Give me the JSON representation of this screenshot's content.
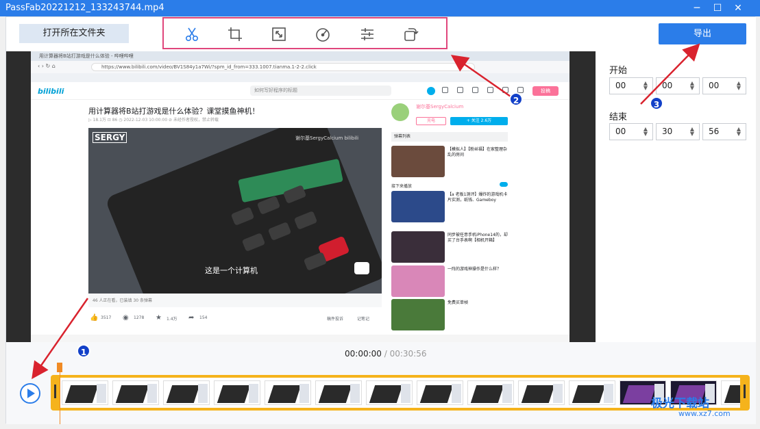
{
  "window": {
    "title": "PassFab20221212_133243744.mp4",
    "minimize_glyph": "─",
    "maximize_glyph": "☐",
    "close_glyph": "✕"
  },
  "toolbar": {
    "open_folder_label": "打开所在文件夹",
    "export_label": "导出",
    "tools": [
      "scissors-icon",
      "crop-icon",
      "resize-icon",
      "speed-icon",
      "adjust-icon",
      "rotate-icon"
    ]
  },
  "trim": {
    "start_label": "开始",
    "start": [
      "00",
      "00",
      "00"
    ],
    "end_label": "结束",
    "end": [
      "00",
      "30",
      "56"
    ]
  },
  "playback": {
    "current_time": "00:00:00",
    "separator": " / ",
    "total_time": "00:30:56"
  },
  "annotations": {
    "badge_1": "1",
    "badge_2": "2",
    "badge_3": "3",
    "arrow_color": "#d9232e"
  },
  "preview": {
    "browser_tab_1": "用计算器将B站打游戏是什么体验 - 哔哩哔哩",
    "address": "https://www.bilibili.com/video/BV1S84y1a7Wi/?spm_id_from=333.1007.tianma.1-2-2.click",
    "search_placeholder": "如何写好程序的标题",
    "bili_logo": "bilibili",
    "upload_label": "投稿",
    "video_title": "用计算器将B站打游戏是什么体验？课堂摸鱼神机！",
    "video_meta": "▷ 18.1万  ⊡ 86  ◷ 2022-12-03 10:00:00  ⊘ 未经作者授权，禁止转载",
    "channel_mark": "SERGY",
    "video_watermark": "谢尔基SergyCalcium bilibili",
    "subtitle": "这是一个计算机",
    "danmaku_bar": "46 人正在看，已装填 30 条弹幕",
    "like_count": "3517",
    "coin_count": "1278",
    "fav_count": "1.4万",
    "share_count": "154",
    "report_label": "稿件投诉",
    "note_label": "记笔记",
    "up_name": "谢尔基SergyCalcium",
    "charge_label": "充电",
    "follow_label": "+ 关注 2.6万",
    "rec_header": "弹幕列表",
    "rec_1": "【模拟人】【粉丝福】在家整理杂乱的房间",
    "next_header": "接下来播放",
    "rec_2": "【a 老板1测评】爆炸的游戏机卡片实测，纸钱、Gameboy",
    "rec_3": "同步被任意手机iPhone14的，却买了台手表啊【相机开箱】",
    "rec_4": "一阵的游戏神操作是什么样？",
    "rec_5": "免费买单帧"
  },
  "watermark": {
    "brand": "极光下载站",
    "url": "www.xz7.com"
  }
}
